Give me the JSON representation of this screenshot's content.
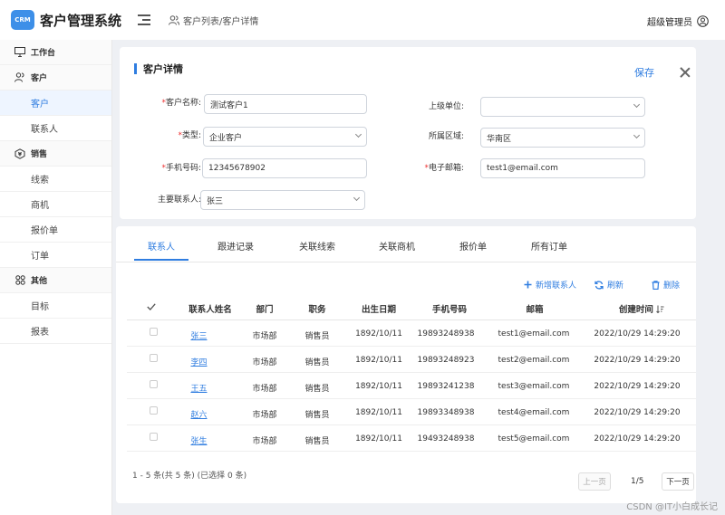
{
  "header": {
    "logo_text": "CRM",
    "app_title": "客户管理系统",
    "breadcrumb": "客户列表/客户详情",
    "user_name": "超级管理员"
  },
  "sidebar": {
    "workbench": "工作台",
    "customer_group": "客户",
    "customer": "客户",
    "contact": "联系人",
    "sales_group": "销售",
    "leads": "线索",
    "opportunities": "商机",
    "quotes": "报价单",
    "orders": "订单",
    "other_group": "其他",
    "goals": "目标",
    "reports": "报表"
  },
  "detail": {
    "title": "客户详情",
    "save_label": "保存",
    "fields": {
      "name_label": "客户名称:",
      "name_value": "测试客户1",
      "parent_label": "上级单位:",
      "parent_value": "",
      "type_label": "类型:",
      "type_value": "企业客户",
      "region_label": "所属区域:",
      "region_value": "华南区",
      "phone_label": "手机号码:",
      "phone_value": "12345678902",
      "email_label": "电子邮箱:",
      "email_value": "test1@email.com",
      "main_contact_label": "主要联系人:",
      "main_contact_value": "张三"
    }
  },
  "tabs": [
    "联系人",
    "跟进记录",
    "关联线索",
    "关联商机",
    "报价单",
    "所有订单"
  ],
  "toolbar": {
    "add_label": "新增联系人",
    "refresh_label": "刷新",
    "delete_label": "删除"
  },
  "table": {
    "columns": [
      "联系人姓名",
      "部门",
      "职务",
      "出生日期",
      "手机号码",
      "邮箱",
      "创建时间"
    ],
    "rows": [
      {
        "name": "张三",
        "dept": "市场部",
        "title": "销售员",
        "birth": "1892/10/11",
        "phone": "19893248938",
        "email": "test1@email.com",
        "created": "2022/10/29 14:29:20"
      },
      {
        "name": "李四",
        "dept": "市场部",
        "title": "销售员",
        "birth": "1892/10/11",
        "phone": "19893248923",
        "email": "test2@email.com",
        "created": "2022/10/29 14:29:20"
      },
      {
        "name": "王五",
        "dept": "市场部",
        "title": "销售员",
        "birth": "1892/10/11",
        "phone": "19893241238",
        "email": "test3@email.com",
        "created": "2022/10/29 14:29:20"
      },
      {
        "name": "赵六",
        "dept": "市场部",
        "title": "销售员",
        "birth": "1892/10/11",
        "phone": "19893348938",
        "email": "test4@email.com",
        "created": "2022/10/29 14:29:20"
      },
      {
        "name": "张生",
        "dept": "市场部",
        "title": "销售员",
        "birth": "1892/10/11",
        "phone": "19493248938",
        "email": "test5@email.com",
        "created": "2022/10/29 14:29:20"
      }
    ]
  },
  "pagination": {
    "summary": "1 - 5 条(共 5 条) (已选择 0 条)",
    "prev_label": "上一页",
    "page_indicator": "1/5",
    "next_label": "下一页"
  },
  "footer_credit": "CSDN @IT小白成长记",
  "colors": {
    "accent": "#2f7de0",
    "required": "#e33333"
  }
}
